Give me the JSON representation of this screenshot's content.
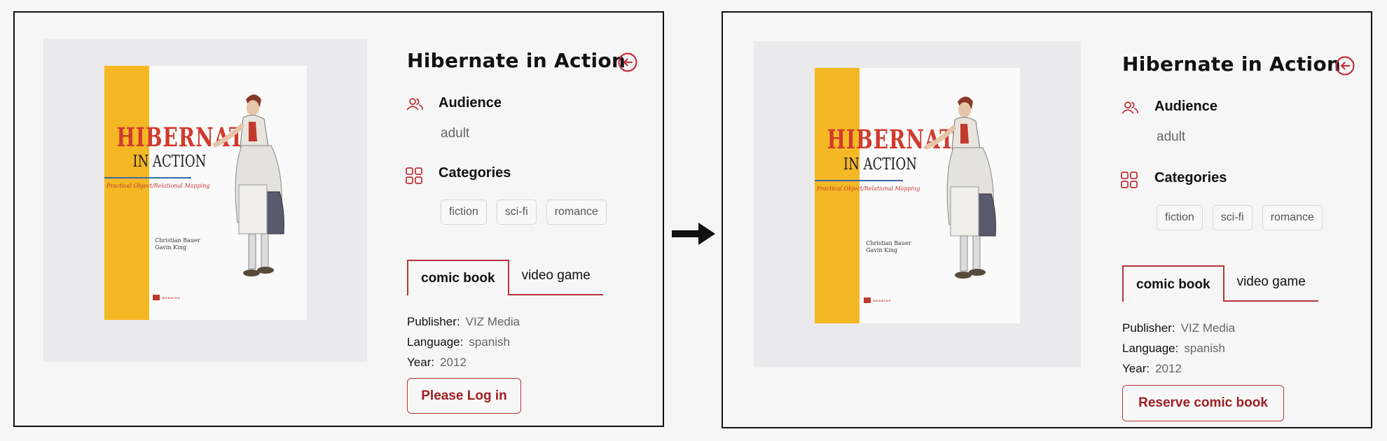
{
  "accent_color": "#b8343a",
  "panels": [
    {
      "title": "Hibernate in Action",
      "cover": {
        "title_line1": "HIBERNATE",
        "title_line2": "IN ACTION",
        "tagline": "Practical Object/Relational Mapping",
        "author1": "Christian Bauer",
        "author2": "Gavin King",
        "publisher_logo": "MANNING"
      },
      "audience_label": "Audience",
      "audience_value": "adult",
      "categories_label": "Categories",
      "categories": [
        "fiction",
        "sci-fi",
        "romance"
      ],
      "tabs": [
        "comic book",
        "video game"
      ],
      "active_tab": "comic book",
      "publisher_label": "Publisher:",
      "publisher_value": "VIZ Media",
      "language_label": "Language:",
      "language_value": "spanish",
      "year_label": "Year:",
      "year_value": "2012",
      "action_label": "Please Log in"
    },
    {
      "title": "Hibernate in Action",
      "cover": {
        "title_line1": "HIBERNATE",
        "title_line2": "IN ACTION",
        "tagline": "Practical Object/Relational Mapping",
        "author1": "Christian Bauer",
        "author2": "Gavin King",
        "publisher_logo": "MANNING"
      },
      "audience_label": "Audience",
      "audience_value": "adult",
      "categories_label": "Categories",
      "categories": [
        "fiction",
        "sci-fi",
        "romance"
      ],
      "tabs": [
        "comic book",
        "video game"
      ],
      "active_tab": "comic book",
      "publisher_label": "Publisher:",
      "publisher_value": "VIZ Media",
      "language_label": "Language:",
      "language_value": "spanish",
      "year_label": "Year:",
      "year_value": "2012",
      "action_label": "Reserve comic book"
    }
  ]
}
